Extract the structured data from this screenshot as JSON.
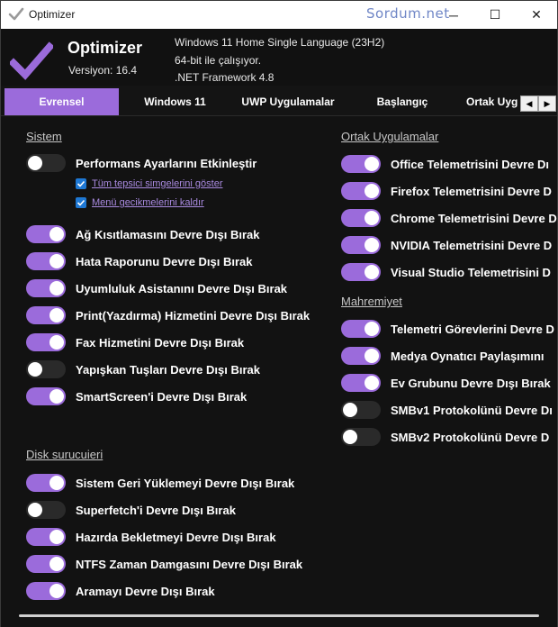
{
  "window": {
    "title": "Optimizer",
    "watermark": "Sordum.net",
    "controls": {
      "minimize": "─",
      "maximize": "☐",
      "close": "✕"
    }
  },
  "header": {
    "app_name": "Optimizer",
    "version": "Versiyon: 16.4",
    "sysinfo": [
      "Windows 11 Home Single Language (23H2)",
      "64-bit ile çalışıyor.",
      ".NET Framework 4.8"
    ]
  },
  "tabs": [
    {
      "label": "Evrensel",
      "active": true
    },
    {
      "label": "Windows 11",
      "active": false
    },
    {
      "label": "UWP Uygulamalar",
      "active": false
    },
    {
      "label": "Başlangıç",
      "active": false
    },
    {
      "label": "Ortak Uyg",
      "active": false
    }
  ],
  "tab_scroll": {
    "left": "◀",
    "right": "▶"
  },
  "left": {
    "sistem": {
      "title": "Sistem",
      "performance": {
        "label": "Performans Ayarlarını Etkinleştir",
        "on": false
      },
      "checks": [
        {
          "label": "Tüm tepsici simgelerini göster",
          "checked": true
        },
        {
          "label": "Menü gecikmelerini kaldır",
          "checked": true
        }
      ],
      "toggles": [
        {
          "label": "Ağ Kısıtlamasını Devre Dışı Bırak",
          "on": true
        },
        {
          "label": "Hata Raporunu Devre Dışı Bırak",
          "on": true
        },
        {
          "label": "Uyumluluk Asistanını Devre Dışı Bırak",
          "on": true
        },
        {
          "label": "Print(Yazdırma) Hizmetini Devre Dışı Bırak",
          "on": true
        },
        {
          "label": "Fax Hizmetini Devre Dışı Bırak",
          "on": true
        },
        {
          "label": "Yapışkan Tuşları Devre Dışı Bırak",
          "on": false
        },
        {
          "label": "SmartScreen'i Devre Dışı Bırak",
          "on": true
        }
      ]
    },
    "disk": {
      "title": "Disk surucuieri",
      "toggles": [
        {
          "label": "Sistem Geri Yüklemeyi Devre Dışı Bırak",
          "on": true
        },
        {
          "label": "Superfetch'i Devre Dışı Bırak",
          "on": false
        },
        {
          "label": "Hazırda Bekletmeyi Devre Dışı Bırak",
          "on": true
        },
        {
          "label": "NTFS Zaman Damgasını Devre Dışı Bırak",
          "on": true
        },
        {
          "label": "Aramayı Devre Dışı Bırak",
          "on": true
        }
      ]
    }
  },
  "right": {
    "ortak": {
      "title": "Ortak Uygulamalar",
      "toggles": [
        {
          "label": "Office Telemetrisini Devre Dı",
          "on": true
        },
        {
          "label": "Firefox Telemetrisini Devre D",
          "on": true
        },
        {
          "label": "Chrome Telemetrisini Devre D",
          "on": true
        },
        {
          "label": "NVIDIA Telemetrisini Devre D",
          "on": true
        },
        {
          "label": "Visual Studio Telemetrisini D",
          "on": true
        }
      ]
    },
    "mahremiyet": {
      "title": "Mahremiyet",
      "toggles": [
        {
          "label": "Telemetri Görevlerini Devre D",
          "on": true
        },
        {
          "label": "Medya Oynatıcı Paylaşımını",
          "on": true
        },
        {
          "label": "Ev Grubunu Devre Dışı Bırak",
          "on": true
        },
        {
          "label": "SMBv1 Protokolünü Devre Dı",
          "on": false
        },
        {
          "label": "SMBv2 Protokolünü Devre D",
          "on": false
        }
      ]
    }
  },
  "colors": {
    "accent": "#9b6bdb",
    "toggle_off": "#2a2a2a",
    "checkbox": "#1e78d4",
    "link": "#a98ae0"
  }
}
